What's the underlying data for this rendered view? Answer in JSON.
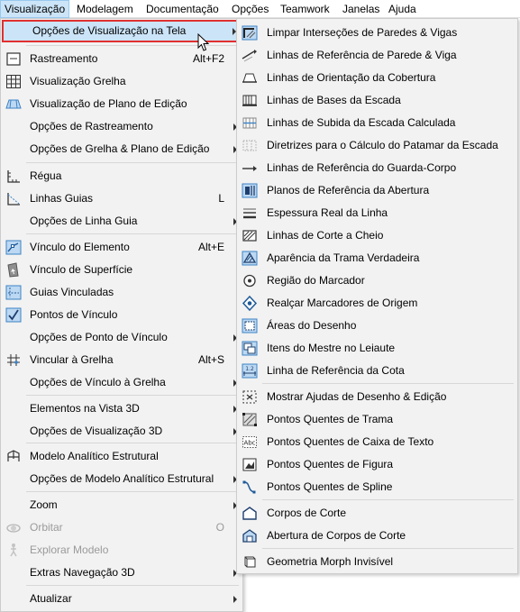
{
  "menubar": {
    "items": [
      "Visualização",
      "Modelagem",
      "Documentação",
      "Opções",
      "Teamwork",
      "Janelas",
      "Ajuda"
    ]
  },
  "menu_left": {
    "items": [
      {
        "label": "Opções de Visualização na Tela",
        "shortcut": "",
        "icon": "none"
      },
      {
        "label": "Rastreamento",
        "shortcut": "Alt+F2",
        "icon": "tracker-icon"
      },
      {
        "label": "Visualização Grelha",
        "shortcut": "",
        "icon": "grid-icon"
      },
      {
        "label": "Visualização de Plano de Edição",
        "shortcut": "",
        "icon": "editing-plane-icon"
      },
      {
        "label": "Opções de Rastreamento",
        "shortcut": "",
        "icon": "none"
      },
      {
        "label": "Opções de Grelha & Plano de Edição",
        "shortcut": "",
        "icon": "none"
      },
      {
        "label": "Régua",
        "shortcut": "",
        "icon": "ruler-icon"
      },
      {
        "label": "Linhas Guias",
        "shortcut": "L",
        "icon": "guide-lines-icon"
      },
      {
        "label": "Opções de Linha Guia",
        "shortcut": "",
        "icon": "none"
      },
      {
        "label": "Vínculo do Elemento",
        "shortcut": "Alt+E",
        "icon": "element-snap-icon"
      },
      {
        "label": "Vínculo de Superfície",
        "shortcut": "",
        "icon": "surface-snap-icon"
      },
      {
        "label": "Guias Vinculadas",
        "shortcut": "",
        "icon": "snap-guides-icon"
      },
      {
        "label": "Pontos de Vínculo",
        "shortcut": "",
        "icon": "snap-points-icon"
      },
      {
        "label": "Opções de Ponto de Vínculo",
        "shortcut": "",
        "icon": "none"
      },
      {
        "label": "Vincular à Grelha",
        "shortcut": "Alt+S",
        "icon": "snap-to-grid-icon"
      },
      {
        "label": "Opções de Vínculo à Grelha",
        "shortcut": "",
        "icon": "none"
      },
      {
        "label": "Elementos na Vista 3D",
        "shortcut": "",
        "icon": "none"
      },
      {
        "label": "Opções de Visualização 3D",
        "shortcut": "",
        "icon": "none"
      },
      {
        "label": "Modelo Analítico Estrutural",
        "shortcut": "",
        "icon": "structural-model-icon"
      },
      {
        "label": "Opções de Modelo Analítico Estrutural",
        "shortcut": "",
        "icon": "none"
      },
      {
        "label": "Zoom",
        "shortcut": "",
        "icon": "none"
      },
      {
        "label": "Orbitar",
        "shortcut": "O",
        "icon": "orbit-icon"
      },
      {
        "label": "Explorar Modelo",
        "shortcut": "",
        "icon": "explore-model-icon"
      },
      {
        "label": "Extras Navegação 3D",
        "shortcut": "",
        "icon": "none"
      },
      {
        "label": "Atualizar",
        "shortcut": "",
        "icon": "none"
      }
    ]
  },
  "menu_right": {
    "items": [
      {
        "label": "Limpar Interseções  de Paredes & Vigas",
        "icon": "clean-intersections-icon"
      },
      {
        "label": "Linhas de Referência de Parede & Viga",
        "icon": "wall-reference-line-icon"
      },
      {
        "label": "Linhas de Orientação da Cobertura",
        "icon": "roof-pivot-lines-icon"
      },
      {
        "label": "Linhas de Bases da Escada",
        "icon": "stair-baseline-icon"
      },
      {
        "label": "Linhas de Subida da Escada Calculada",
        "icon": "stair-walking-line-icon"
      },
      {
        "label": "Diretrizes para o Cálculo do Patamar da Escada",
        "icon": "landing-guidelines-icon"
      },
      {
        "label": "Linhas de Referência do Guarda-Corpo",
        "icon": "railing-reference-line-icon"
      },
      {
        "label": "Planos de Referência da Abertura",
        "icon": "opening-reference-plane-icon"
      },
      {
        "label": "Espessura Real da Linha",
        "icon": "true-line-weight-icon"
      },
      {
        "label": "Linhas de Corte a Cheio",
        "icon": "bold-cut-lines-icon"
      },
      {
        "label": "Aparência da Trama Verdadeira",
        "icon": "vectorial-hatching-icon"
      },
      {
        "label": "Região do Marcador",
        "icon": "marker-region-icon"
      },
      {
        "label": "Realçar Marcadores de Origem",
        "icon": "highlight-source-markers-icon"
      },
      {
        "label": "Áreas do Desenho",
        "icon": "drawing-frames-icon"
      },
      {
        "label": "Itens do Mestre no Leiaute",
        "icon": "master-items-icon"
      },
      {
        "label": "Linha de Referência da Cota",
        "icon": "dimension-reference-line-icon"
      },
      {
        "label": "Mostrar Ajudas de Desenho & Edição",
        "icon": "drafting-aids-icon"
      },
      {
        "label": "Pontos Quentes de Trama",
        "icon": "fill-hotspots-icon"
      },
      {
        "label": "Pontos Quentes de Caixa de Texto",
        "icon": "text-box-hotspots-icon"
      },
      {
        "label": "Pontos Quentes de Figura",
        "icon": "figure-hotspots-icon"
      },
      {
        "label": "Pontos Quentes de Spline",
        "icon": "spline-hotspots-icon"
      },
      {
        "label": "Corpos de Corte",
        "icon": "solid-cut-bodies-icon"
      },
      {
        "label": "Abertura de Corpos de Corte",
        "icon": "opening-cut-bodies-icon"
      },
      {
        "label": "Geometria Morph Invisível",
        "icon": "invisible-morph-geometry-icon"
      }
    ]
  },
  "colors": {
    "menu_bg": "#f2f2f2",
    "highlight_bg": "#cce4f7",
    "highlight_border": "#e0302f",
    "icon_blue": "#3c82c4",
    "disabled_text": "#9a9a9a"
  }
}
